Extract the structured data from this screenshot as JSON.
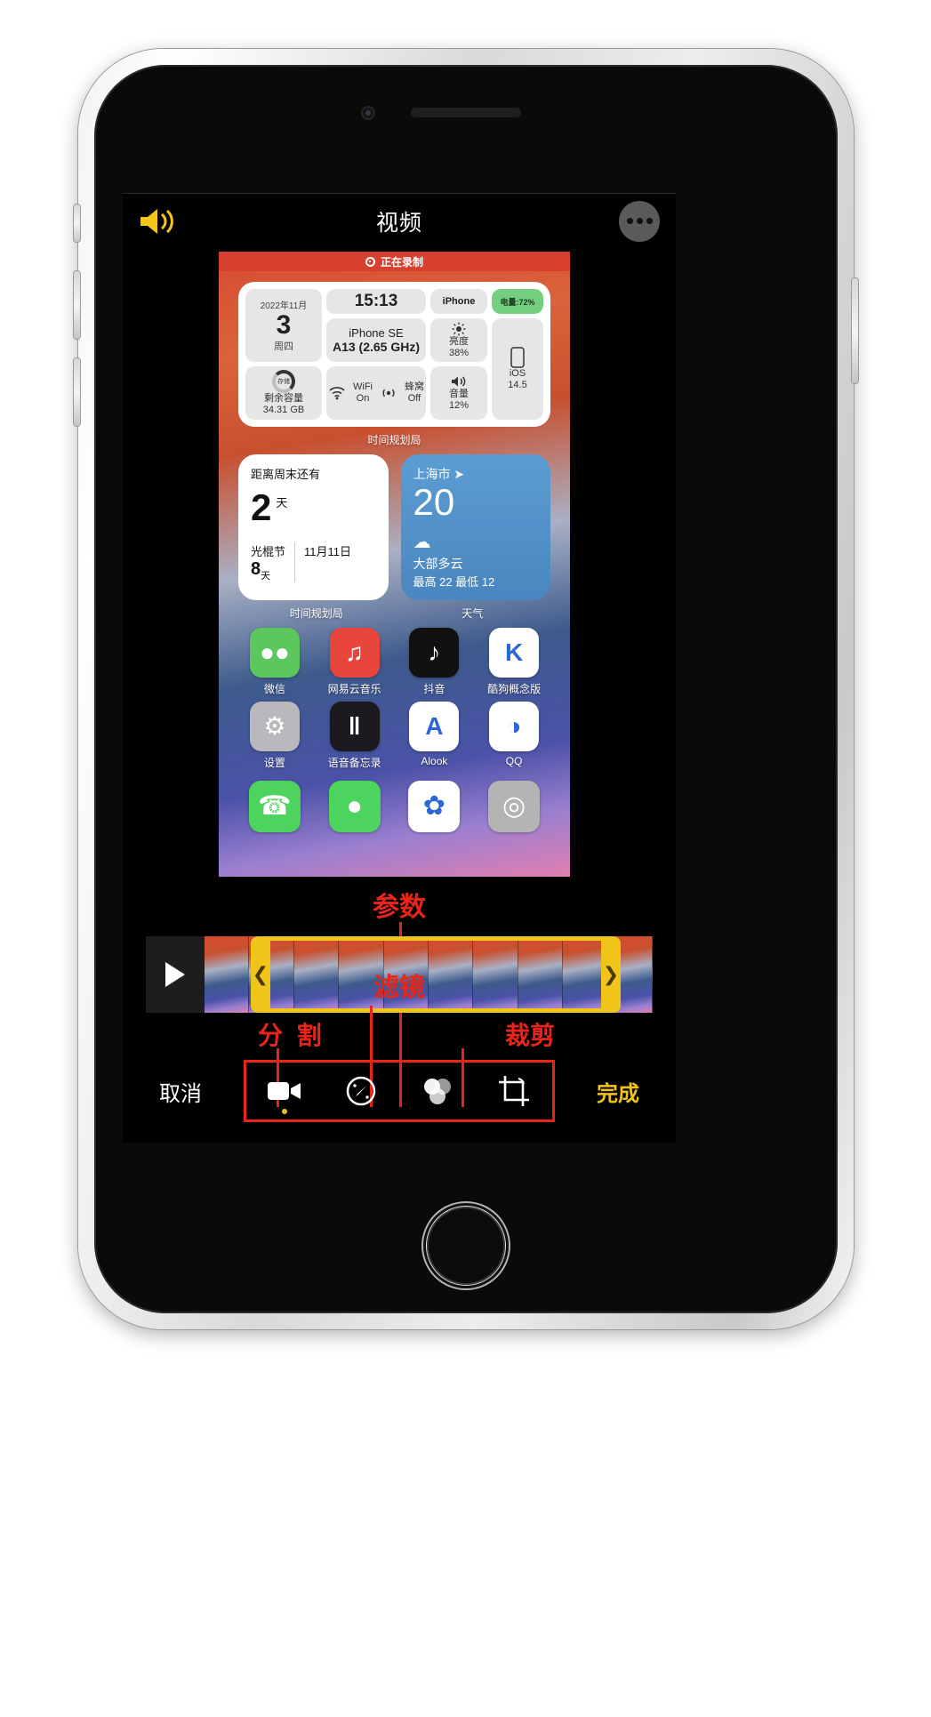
{
  "app": {
    "header": {
      "title": "视频",
      "speaker_icon": "speaker-wave-icon",
      "more_icon": "more-ellipsis-icon"
    }
  },
  "video_preview": {
    "recording_banner": {
      "icon": "record-dot-icon",
      "text": "正在录制"
    },
    "system_widget": {
      "date": {
        "month": "2022年11月",
        "day": "3",
        "weekday": "周四"
      },
      "time": "15:13",
      "device_label": "iPhone",
      "battery": "电量:72%",
      "chip": {
        "model": "iPhone SE",
        "cpu": " A13 (2.65 GHz)"
      },
      "brightness": {
        "icon": "sun-icon",
        "label": "亮度",
        "value": "38%"
      },
      "ios": {
        "icon": "phone-icon",
        "label": "iOS",
        "value": "14.5"
      },
      "storage": {
        "ring_label": "存储",
        "label": "剩余容量",
        "value": "34.31 GB"
      },
      "wifi": {
        "icon": "wifi-icon",
        "label": "WiFi",
        "value": "On"
      },
      "cellular": {
        "icon": "cellular-icon",
        "label": "蜂窝",
        "value": "Off"
      },
      "volume": {
        "icon": "volume-icon",
        "label": "音量",
        "value": "12%"
      },
      "widget_name": "时间规划局"
    },
    "calendar_widget": {
      "title": "距离周末还有",
      "days": "2",
      "days_unit": "天",
      "festival": "光棍节",
      "festival_days": "8",
      "festival_unit": "天",
      "festival_date": "11月11日",
      "widget_name": "时间规划局"
    },
    "weather_widget": {
      "city": "上海市",
      "location_icon": "location-arrow-icon",
      "temp": "20",
      "cloud_icon": "cloud-icon",
      "condition": "大部多云",
      "range": "最高 22 最低 12",
      "widget_name": "天气"
    },
    "apps": [
      {
        "name": "微信",
        "icon": "wechat-icon",
        "bg": "#5cc75e",
        "glyph": "●●"
      },
      {
        "name": "网易云音乐",
        "icon": "netease-music-icon",
        "bg": "#e8453c",
        "glyph": "♫"
      },
      {
        "name": "抖音",
        "icon": "tiktok-icon",
        "bg": "#111111",
        "glyph": "♪"
      },
      {
        "name": "酷狗概念版",
        "icon": "kugou-icon",
        "bg": "#ffffff",
        "glyph": "K"
      },
      {
        "name": "设置",
        "icon": "settings-gear-icon",
        "bg": "#b9b9bd",
        "glyph": "⚙"
      },
      {
        "name": "语音备忘录",
        "icon": "voice-memos-icon",
        "bg": "#1b1b1f",
        "glyph": "‖"
      },
      {
        "name": "Alook",
        "icon": "alook-browser-icon",
        "bg": "#ffffff",
        "glyph": "A"
      },
      {
        "name": "QQ",
        "icon": "qq-icon",
        "bg": "#ffffff",
        "glyph": "◑"
      }
    ],
    "dock": [
      {
        "name": "电话",
        "icon": "phone-app-icon",
        "bg": "#4cd45f",
        "glyph": "☎"
      },
      {
        "name": "信息",
        "icon": "messages-app-icon",
        "bg": "#4cd45f",
        "glyph": "●"
      },
      {
        "name": "照片",
        "icon": "photos-app-icon",
        "bg": "#ffffff",
        "glyph": "✿"
      },
      {
        "name": "相机",
        "icon": "camera-app-icon",
        "bg": "#b4b4b4",
        "glyph": "◎"
      }
    ]
  },
  "editor": {
    "annotations": {
      "param": "参数",
      "filter": "滤镜",
      "split": "分 割",
      "crop": "裁剪",
      "color": "#e8251a"
    },
    "play_button": "play-triangle-icon",
    "trim_handle_left": "❮",
    "trim_handle_right": "❯",
    "trim_color": "#f0c419",
    "cancel_label": "取消",
    "done_label": "完成",
    "tools": [
      {
        "name": "split-tool",
        "icon": "video-camera-icon",
        "selected": true
      },
      {
        "name": "adjust-tool",
        "icon": "adjust-dial-icon",
        "selected": false
      },
      {
        "name": "filter-tool",
        "icon": "filter-circles-icon",
        "selected": false
      },
      {
        "name": "crop-tool",
        "icon": "crop-rotate-icon",
        "selected": false
      }
    ]
  }
}
